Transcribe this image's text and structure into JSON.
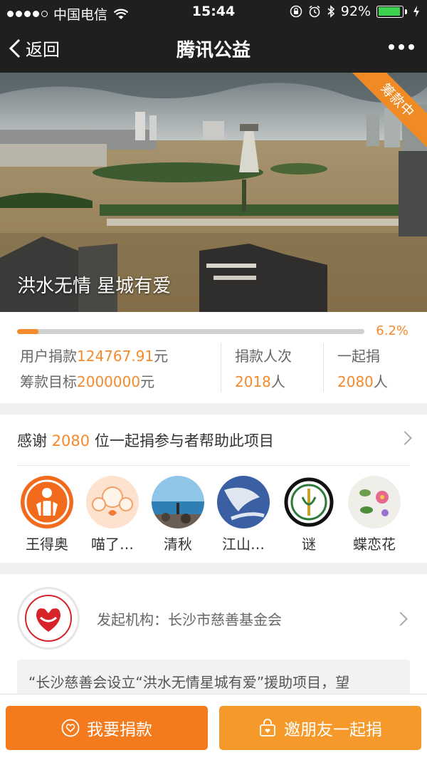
{
  "status_bar": {
    "carrier": "中国电信",
    "time": "15:44",
    "battery_percent": "92%",
    "battery_level": 0.92
  },
  "nav": {
    "back_label": "返回",
    "title": "腾讯公益"
  },
  "banner": {
    "caption": "洪水无情 星城有爱",
    "ribbon": "筹款中"
  },
  "progress": {
    "percent_label": "6.2%",
    "fraction": 0.062,
    "raised_label": "用户捐款",
    "raised_value": "124767.91",
    "raised_unit": "元",
    "goal_label": "筹款目标",
    "goal_value": "2000000",
    "goal_unit": "元",
    "donations_label": "捐款人次",
    "donations_value": "2018",
    "donations_unit": "人",
    "together_label": "一起捐",
    "together_value": "2080",
    "together_unit": "人"
  },
  "supporters": {
    "thanks_prefix": "感谢 ",
    "thanks_count": "2080",
    "thanks_suffix": " 位一起捐参与者帮助此项目",
    "people": [
      {
        "name": "王得奥"
      },
      {
        "name": "喵了…"
      },
      {
        "name": "清秋"
      },
      {
        "name": "江山…"
      },
      {
        "name": "谜"
      },
      {
        "name": "蝶恋花"
      }
    ]
  },
  "organization": {
    "label": "发起机构：长沙市慈善基金会",
    "quote": "“长沙慈善会设立“洪水无情星城有爱”援助项目，望"
  },
  "actions": {
    "donate_label": "我要捐款",
    "invite_label": "邀朋友一起捐"
  },
  "colors": {
    "accent": "#f58a2b",
    "dark_bar": "#1f1f1f"
  }
}
